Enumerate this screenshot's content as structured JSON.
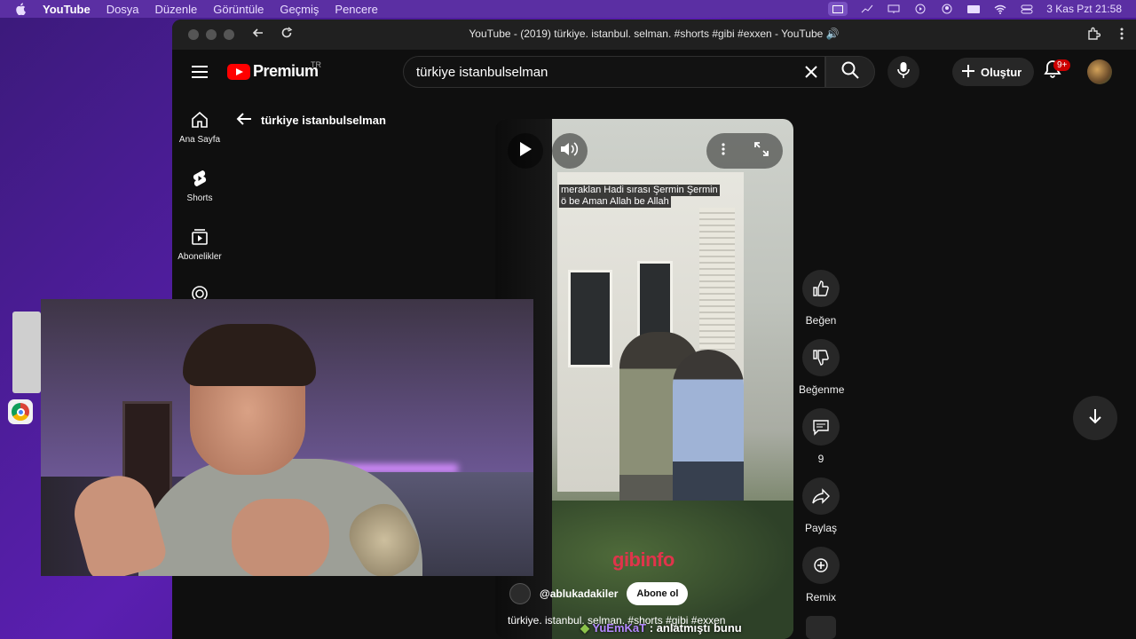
{
  "menubar": {
    "app": "YouTube",
    "items": [
      "Dosya",
      "Düzenle",
      "Görüntüle",
      "Geçmiş",
      "Pencere"
    ],
    "clock": "3 Kas Pzt  21:58"
  },
  "browser": {
    "title": "YouTube - (2019) türkiye. istanbul. selman. #shorts #gibi #exxen - YouTube 🔊"
  },
  "header": {
    "logo_text": "Premium",
    "country": "TR",
    "search_value": "türkiye  istanbulselman",
    "create_label": "Oluştur",
    "notif_badge": "9+"
  },
  "sidebar": {
    "items": [
      {
        "label": "Ana Sayfa",
        "icon": "home-icon"
      },
      {
        "label": "Shorts",
        "icon": "shorts-icon"
      },
      {
        "label": "Abonelikler",
        "icon": "subscriptions-icon"
      }
    ]
  },
  "page": {
    "back_title": "türkiye istanbulselman"
  },
  "video": {
    "caption_line1": "meraklan Hadi sırası Şermin Şermin",
    "caption_line2": "ö be Aman Allah be Allah",
    "watermark": "gibinfo",
    "channel": "@ablukadakiler",
    "subscribe_label": "Abone ol",
    "title": "türkiye. istanbul. selman.  #shorts #gibi #exxen",
    "overlay_nick": "YuEmKaT",
    "overlay_msg": ": anlatmıştı bunu"
  },
  "actions": {
    "like": "Beğen",
    "dislike": "Beğenme",
    "comments": "9",
    "share": "Paylaş",
    "remix": "Remix"
  }
}
